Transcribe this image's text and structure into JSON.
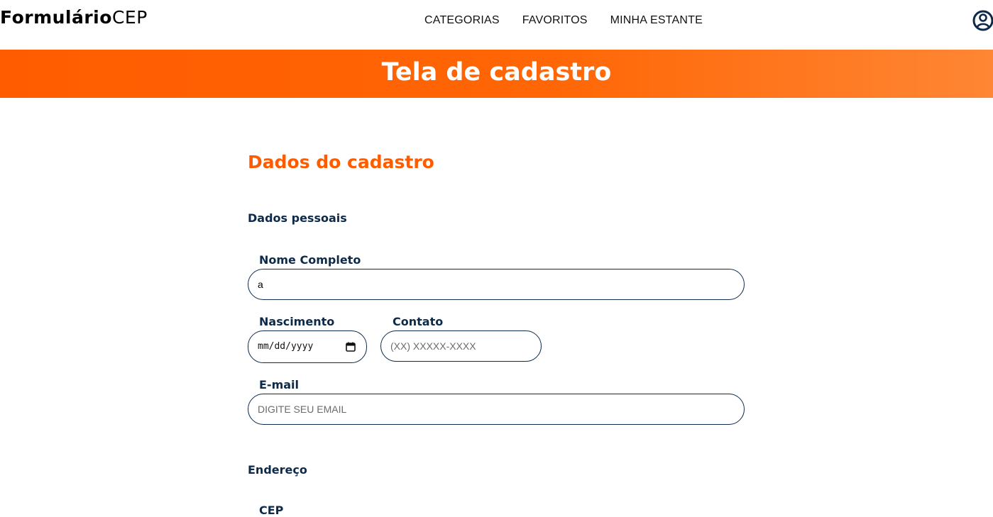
{
  "header": {
    "logo_bold": "Formulário",
    "logo_light": "CEP",
    "nav": [
      {
        "label": "CATEGORIAS"
      },
      {
        "label": "FAVORITOS"
      },
      {
        "label": "MINHA ESTANTE"
      }
    ],
    "user_icon": "user-circle-icon"
  },
  "banner": {
    "title": "Tela de cadastro"
  },
  "form": {
    "title": "Dados do cadastro",
    "personal": {
      "title": "Dados pessoais",
      "name_label": "Nome Completo",
      "name_value": "a",
      "birth_label": "Nascimento",
      "birth_display": "mm/dd/yyyy",
      "contact_label": "Contato",
      "contact_placeholder": "(XX) XXXXX-XXXX",
      "email_label": "E-mail",
      "email_placeholder": "DIGITE SEU EMAIL"
    },
    "address": {
      "title": "Endereço",
      "cep_label": "CEP"
    }
  },
  "colors": {
    "accent": "#ff5c00",
    "dark": "#0d2a4a"
  }
}
